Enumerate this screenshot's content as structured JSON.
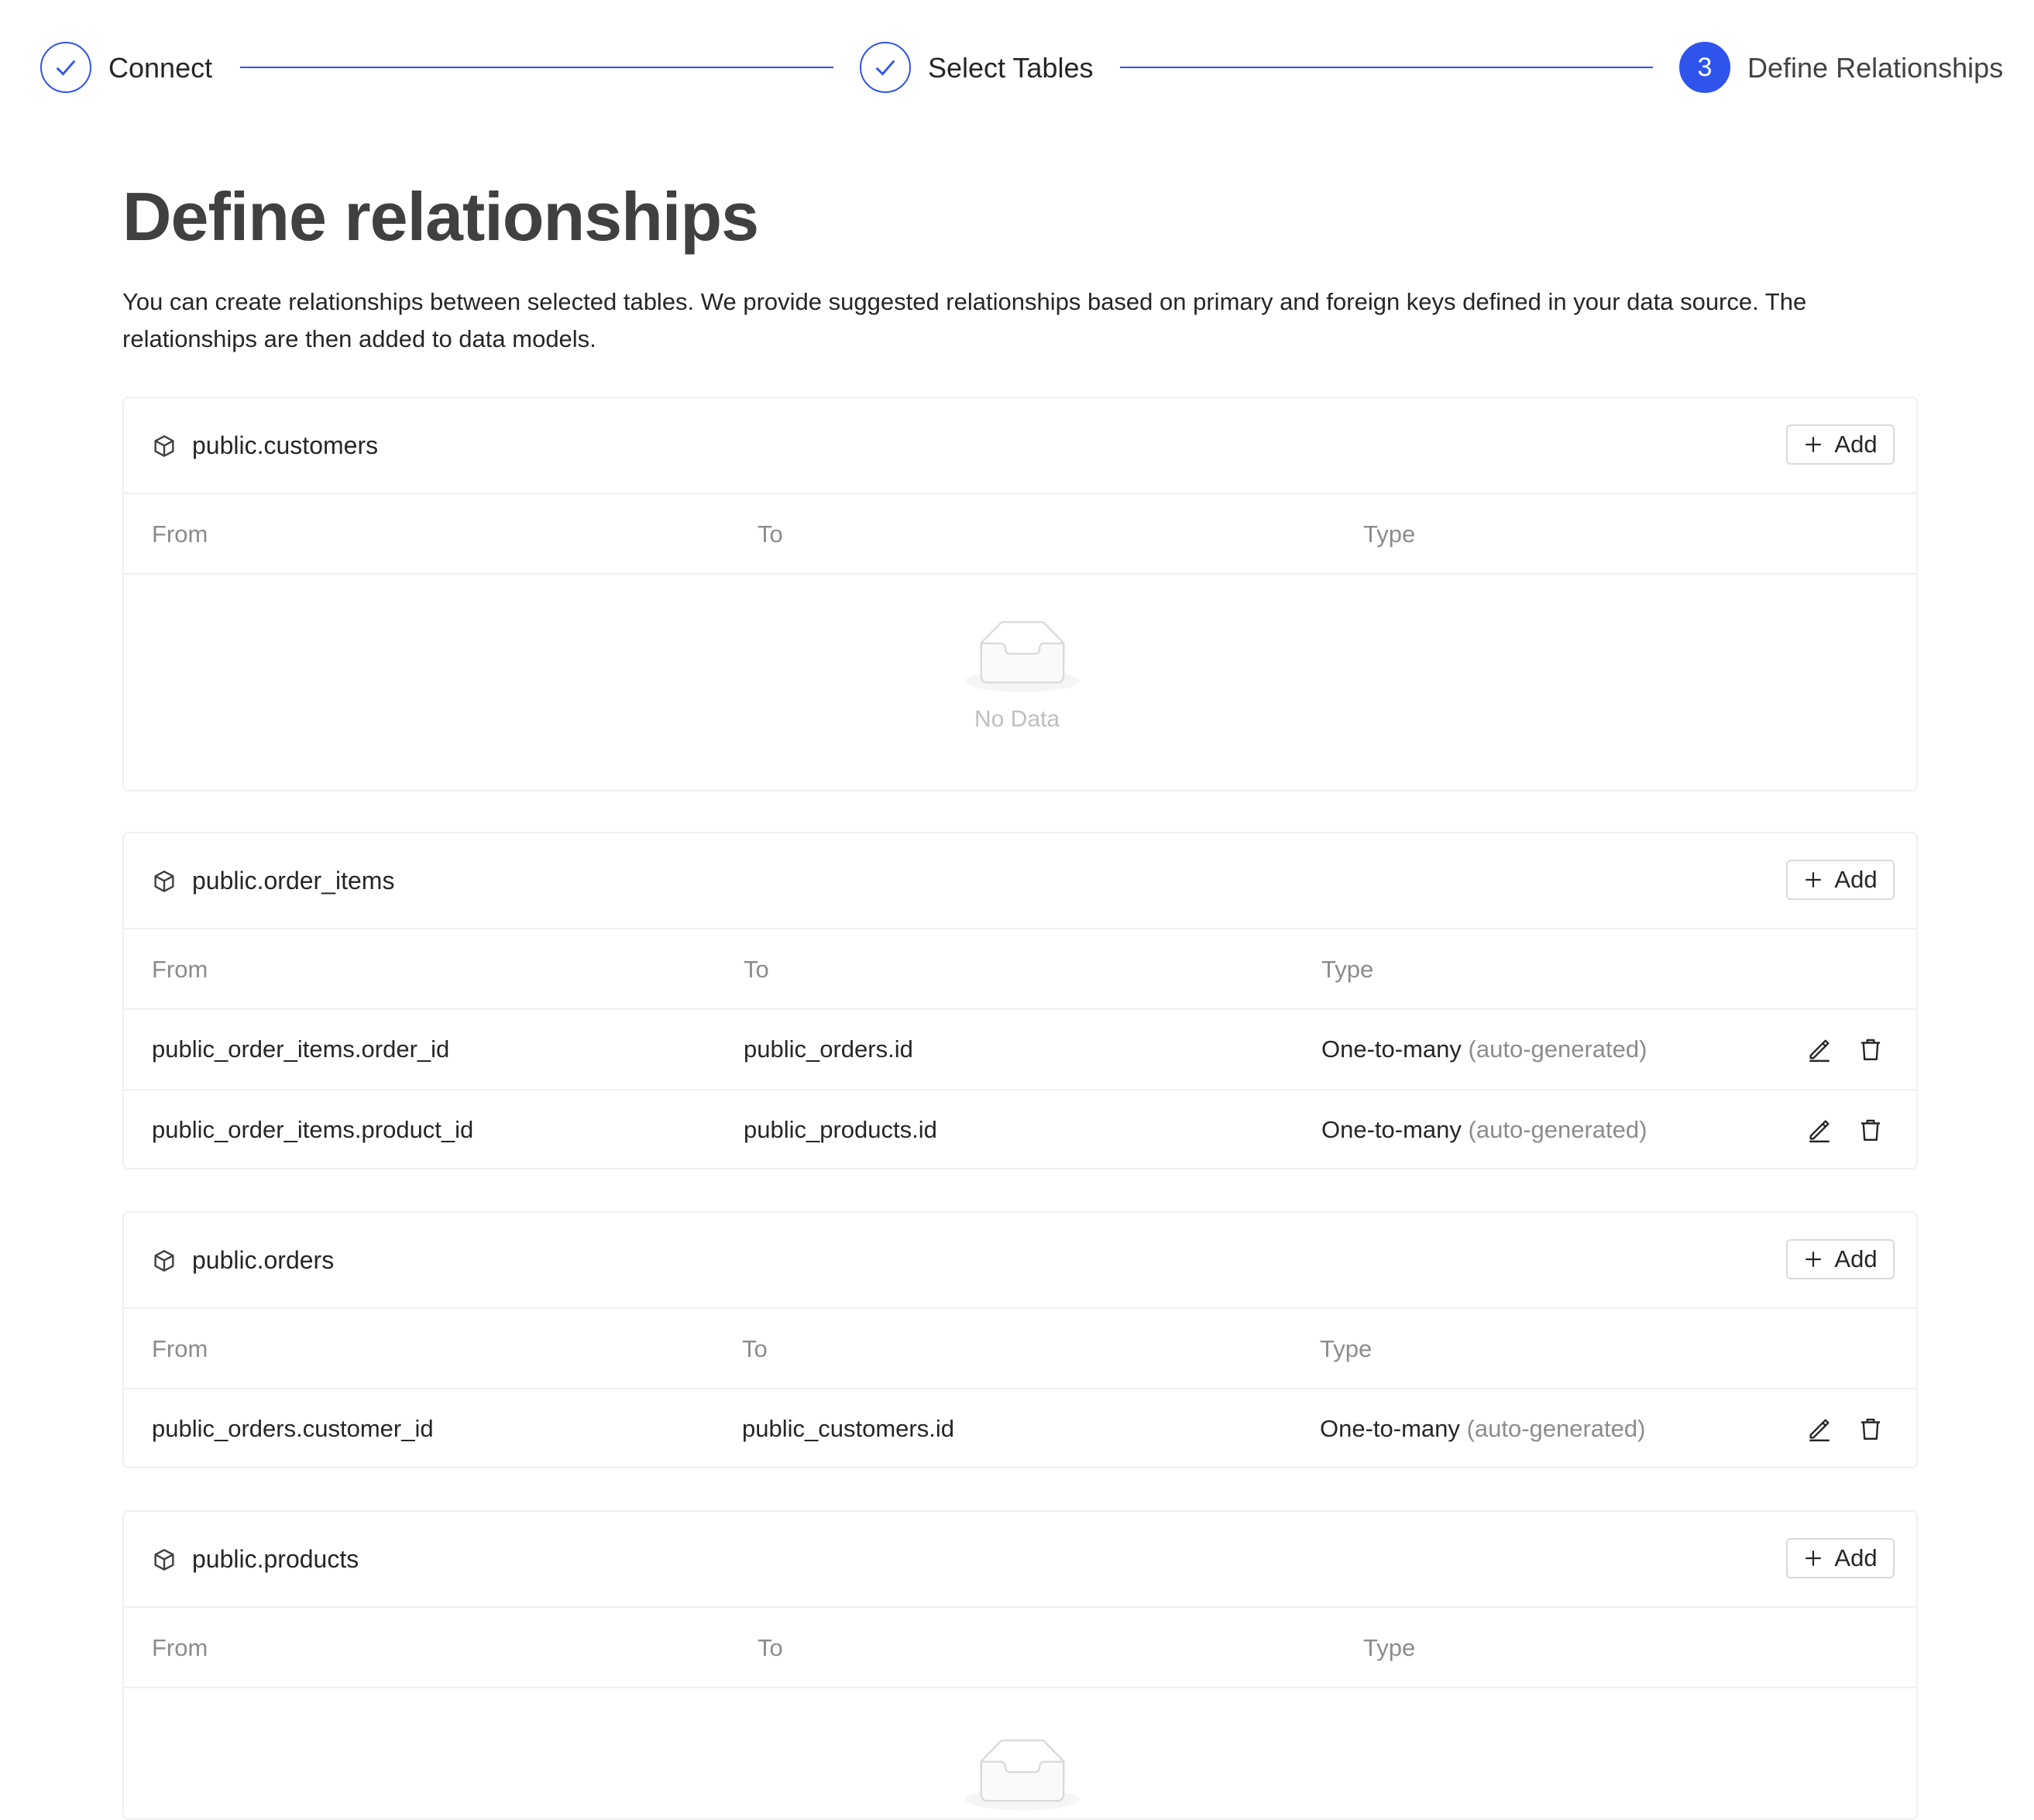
{
  "steps": [
    {
      "label": "Connect",
      "status": "finished",
      "icon": "check-icon"
    },
    {
      "label": "Select Tables",
      "status": "finished",
      "icon": "check-icon"
    },
    {
      "number": "3",
      "label": "Define Relationships",
      "status": "active"
    }
  ],
  "header": {
    "title": "Define relationships",
    "description": "You can create relationships between selected tables. We provide suggested relationships based on primary and foreign keys defined in your data source. The relationships are then added to data models."
  },
  "columns": {
    "from": "From",
    "to": "To",
    "type": "Type"
  },
  "add_label": "Add",
  "empty_text": "No Data",
  "tables": [
    {
      "name": "public.customers",
      "rows": []
    },
    {
      "name": "public.order_items",
      "rows": [
        {
          "from": "public_order_items.order_id",
          "to": "public_orders.id",
          "type": "One-to-many",
          "note": "(auto-generated)"
        },
        {
          "from": "public_order_items.product_id",
          "to": "public_products.id",
          "type": "One-to-many",
          "note": "(auto-generated)"
        }
      ]
    },
    {
      "name": "public.orders",
      "rows": [
        {
          "from": "public_orders.customer_id",
          "to": "public_customers.id",
          "type": "One-to-many",
          "note": "(auto-generated)"
        }
      ]
    },
    {
      "name": "public.products",
      "rows": []
    }
  ],
  "colors": {
    "accent": "#2f54eb",
    "border": "#f0f0f0",
    "muted": "#8c8c8c"
  }
}
